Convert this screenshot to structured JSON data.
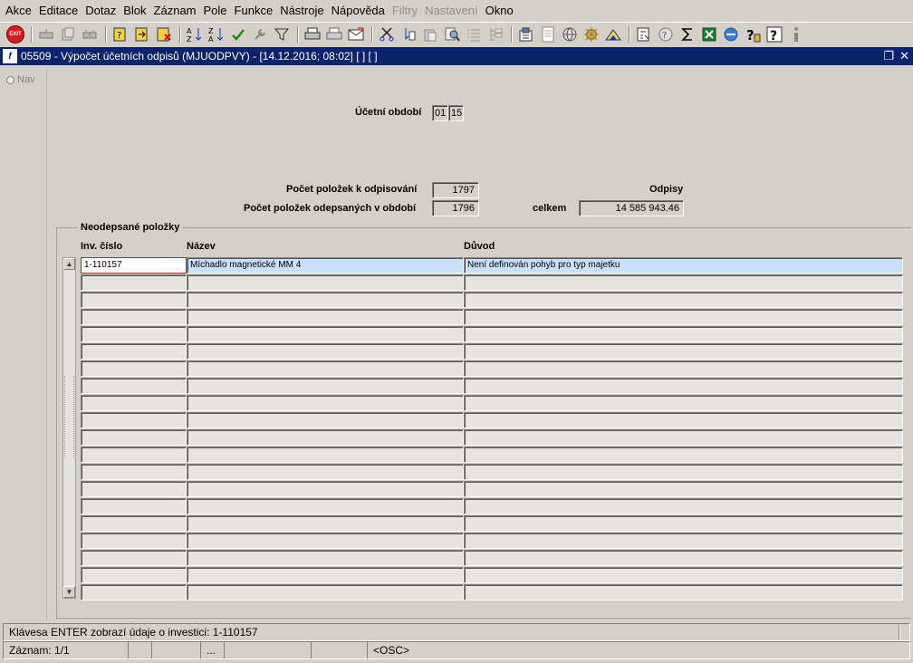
{
  "menu": {
    "items": [
      "Akce",
      "Editace",
      "Dotaz",
      "Blok",
      "Záznam",
      "Pole",
      "Funkce",
      "Nástroje",
      "Nápověda",
      "Filtry",
      "Nastavení",
      "Okno"
    ],
    "disabled": [
      "Filtry",
      "Nastavení"
    ]
  },
  "toolbar": {
    "exit_label": "EXIT",
    "icons": [
      "exit-icon",
      "insert-record-icon",
      "duplicate-record-icon",
      "delete-record-icon",
      "enter-query-icon",
      "execute-query-icon",
      "cancel-query-icon",
      "sort-asc-icon",
      "sort-desc-icon",
      "checkmark-icon",
      "wrench-icon",
      "filter-icon",
      "print-icon",
      "print-setup-icon",
      "mail-icon",
      "cut-icon",
      "copy-icon",
      "paste-icon",
      "find-icon",
      "list-icon",
      "tree-icon",
      "attach-icon",
      "document-icon",
      "globe-icon",
      "wheel-icon",
      "chart-icon",
      "calculator-icon",
      "help-icon",
      "sum-icon",
      "excel-icon",
      "browser-icon",
      "hint-icon",
      "context-help-icon",
      "info-icon"
    ]
  },
  "window": {
    "logo": "f",
    "title": "05509 - Výpočet účetních odpisů (MJUODPVY) - [14.12.2016; 08:02]  [ ]  [ ]",
    "restore_glyph": "❐",
    "close_glyph": "✕"
  },
  "nav": {
    "label": "Nav"
  },
  "form": {
    "period_label": "Účetní období",
    "period_month": "01",
    "period_year": "15",
    "items_to_depreciate_label": "Počet položek k odpisování",
    "items_to_depreciate": "1797",
    "items_depreciated_label": "Počet položek odepsaných v období",
    "items_depreciated": "1796",
    "depreciation_heading": "Odpisy",
    "total_label": "celkem",
    "total_value": "14 585 943.46"
  },
  "group": {
    "title": "Neodepsané položky",
    "columns": [
      "Inv. číslo",
      "Název",
      "Důvod"
    ],
    "rows": [
      [
        "1-110157",
        "Míchadlo magnetické MM 4",
        "Není definován pohyb pro typ majetku"
      ],
      [
        "",
        "",
        ""
      ],
      [
        "",
        "",
        ""
      ],
      [
        "",
        "",
        ""
      ],
      [
        "",
        "",
        ""
      ],
      [
        "",
        "",
        ""
      ],
      [
        "",
        "",
        ""
      ],
      [
        "",
        "",
        ""
      ],
      [
        "",
        "",
        ""
      ],
      [
        "",
        "",
        ""
      ],
      [
        "",
        "",
        ""
      ],
      [
        "",
        "",
        ""
      ],
      [
        "",
        "",
        ""
      ],
      [
        "",
        "",
        ""
      ],
      [
        "",
        "",
        ""
      ],
      [
        "",
        "",
        ""
      ],
      [
        "",
        "",
        ""
      ],
      [
        "",
        "",
        ""
      ],
      [
        "",
        "",
        ""
      ],
      [
        "",
        "",
        ""
      ]
    ]
  },
  "status": {
    "message": "Klávesa ENTER zobrazí údaje o investici: 1-110157",
    "record": "Záznam: 1/1",
    "seg2": "",
    "seg3": "",
    "seg4": "...",
    "seg5": "",
    "seg6": "",
    "mode": "<OSC>"
  }
}
